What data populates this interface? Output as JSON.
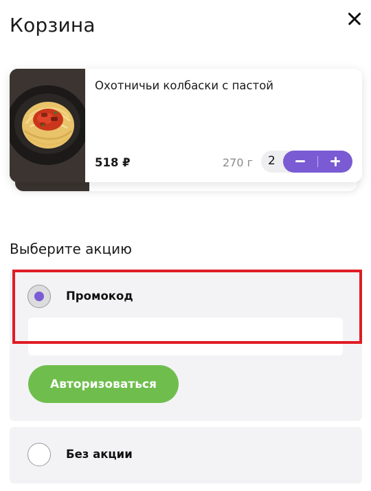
{
  "header": {
    "title": "Корзина",
    "close_icon": "close-icon"
  },
  "cart_item": {
    "name": "Охотничьи колбаски с пастой",
    "price": "518 ₽",
    "weight": "270 г",
    "quantity": "2",
    "image_icon": "pasta-dish-image",
    "decrement_icon": "minus-icon",
    "increment_icon": "plus-icon"
  },
  "promotions": {
    "section_title": "Выберите акцию",
    "options": [
      {
        "label": "Промокод",
        "selected": true
      },
      {
        "label": "Без акции",
        "selected": false
      }
    ],
    "promo_input_value": "",
    "auth_button_label": "Авторизоваться"
  },
  "colors": {
    "accent_purple": "#7a5bd4",
    "button_green": "#6fbe4d",
    "highlight_red": "#e01b24",
    "panel_gray": "#f3f3f5"
  }
}
